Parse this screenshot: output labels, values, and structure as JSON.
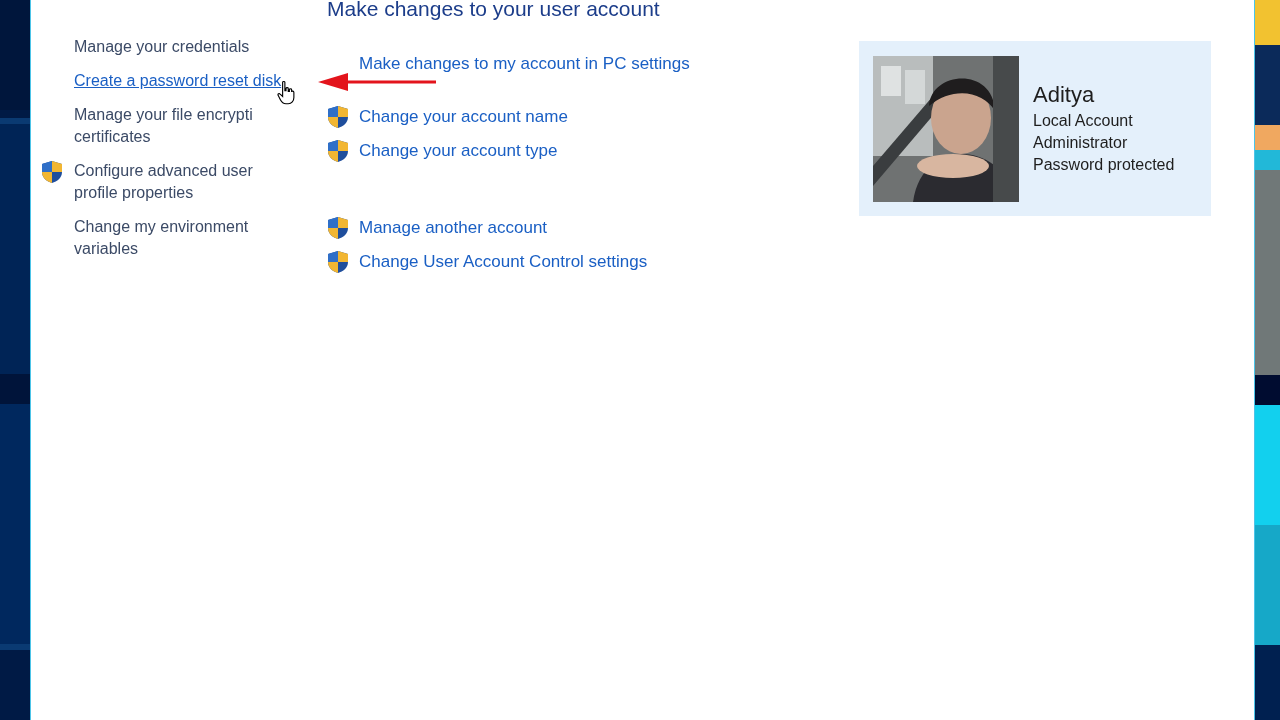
{
  "sidebar": {
    "items": [
      {
        "label": "Manage your credentials",
        "shield": false,
        "hovered": false
      },
      {
        "label": "Create a password reset disk",
        "shield": false,
        "hovered": true
      },
      {
        "label": "Manage your file encrypti",
        "label_2": "certificates",
        "shield": false,
        "hovered": false
      },
      {
        "label": "Configure advanced user",
        "label_2": "profile properties",
        "shield": true,
        "hovered": false
      },
      {
        "label": "Change my environment",
        "label_2": "variables",
        "shield": false,
        "hovered": false
      }
    ]
  },
  "main": {
    "title": "Make changes to your user account",
    "link_groups": [
      [
        {
          "label": "Make changes to my account in PC settings",
          "shield": false
        }
      ],
      [
        {
          "label": "Change your account name",
          "shield": true
        },
        {
          "label": "Change your account type",
          "shield": true
        }
      ],
      [
        {
          "label": "Manage another account",
          "shield": true
        },
        {
          "label": "Change User Account Control settings",
          "shield": true
        }
      ]
    ]
  },
  "account": {
    "name": "Aditya",
    "details": [
      "Local Account",
      "Administrator",
      "Password protected"
    ]
  }
}
